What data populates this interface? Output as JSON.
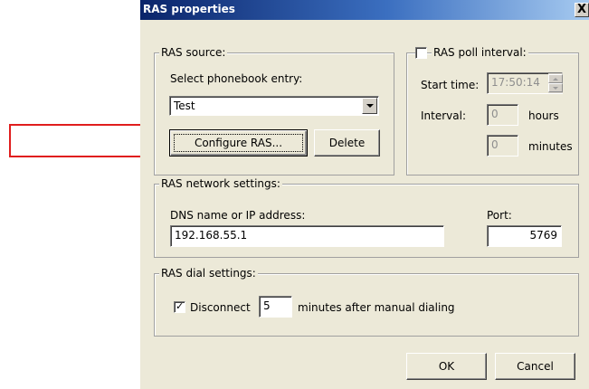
{
  "dialog": {
    "title": "RAS properties",
    "close_glyph": "X"
  },
  "ras_source": {
    "legend": "RAS source:",
    "phonebook_label": "Select phonebook entry:",
    "phonebook_value": "Test",
    "configure_button": "Configure RAS...",
    "delete_button": "Delete"
  },
  "ras_poll": {
    "checkbox_label": "RAS poll interval:",
    "checked": false,
    "start_time_label": "Start time:",
    "start_time_value": "17:50:14",
    "interval_label": "Interval:",
    "hours_value": "0",
    "hours_label": "hours",
    "minutes_value": "0",
    "minutes_label": "minutes"
  },
  "network": {
    "legend": "RAS network settings:",
    "dns_label": "DNS name or IP address:",
    "dns_value": "192.168.55.1",
    "port_label": "Port:",
    "port_value": "5769"
  },
  "dial": {
    "legend": "RAS dial settings:",
    "disconnect_label": "Disconnect",
    "disconnect_checked": true,
    "minutes_value": "5",
    "suffix": "minutes after manual dialing"
  },
  "buttons": {
    "ok": "OK",
    "cancel": "Cancel"
  },
  "colors": {
    "highlight": "#e01e1e",
    "dialog_bg": "#ece9d8",
    "title_bar": "#0a246a"
  }
}
